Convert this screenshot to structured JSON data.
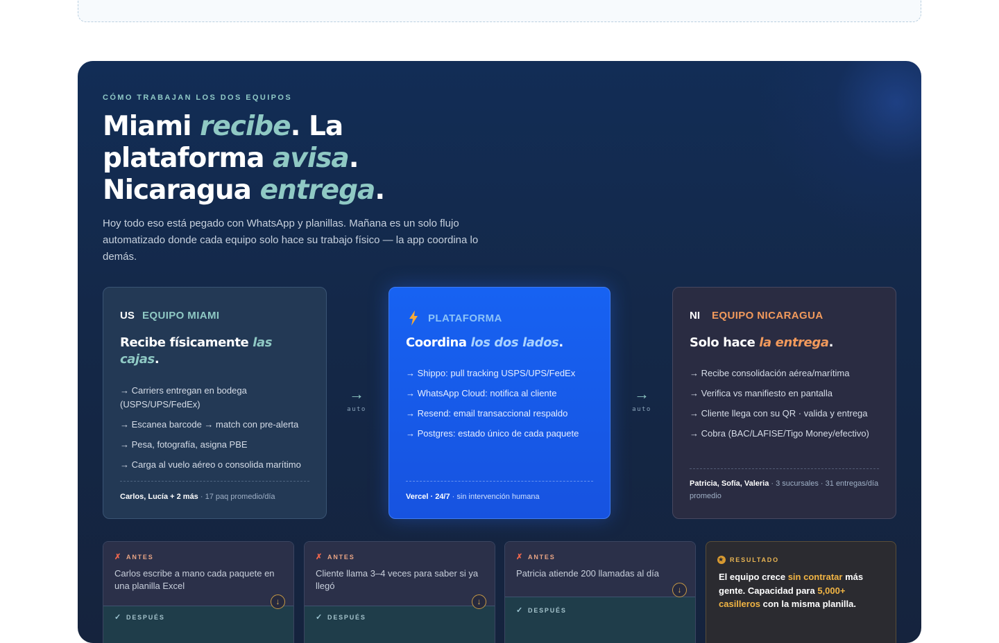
{
  "eyebrow": "CÓMO TRABAJAN LOS DOS EQUIPOS",
  "headline": {
    "l1a": "Miami ",
    "l1b": "recibe",
    "l1c": ". La",
    "l2a": "plataforma ",
    "l2b": "avisa",
    "l2c": ".",
    "l3a": "Nicaragua ",
    "l3b": "entrega",
    "l3c": "."
  },
  "lede": "Hoy todo eso está pegado con WhatsApp y planillas. Mañana es un solo flujo automatizado donde cada equipo solo hace su trabajo físico — la app coordina lo demás.",
  "cards": {
    "miami": {
      "flag": "US",
      "team": "EQUIPO MIAMI",
      "title_a": "Recibe físicamente ",
      "title_b": "las cajas",
      "title_c": ".",
      "bullets": [
        "→ Carriers entregan en bodega (USPS/UPS/FedEx)",
        "→ Escanea barcode → match con pre-alerta",
        "→ Pesa, fotografía, asigna PBE",
        "→ Carga al vuelo aéreo o consolida marítimo"
      ],
      "foot_bold": "Carlos, Lucía + 2 más",
      "foot_rest": " · 17 paq promedio/día"
    },
    "platform": {
      "team": "PLATAFORMA",
      "title_a": "Coordina ",
      "title_b": "los dos lados",
      "title_c": ".",
      "bullets": [
        "→ Shippo: pull tracking USPS/UPS/FedEx",
        "→ WhatsApp Cloud: notifica al cliente",
        "→ Resend: email transaccional respaldo",
        "→ Postgres: estado único de cada paquete"
      ],
      "foot_bold": "Vercel · 24/7",
      "foot_rest": " · sin intervención humana"
    },
    "nicaragua": {
      "flag": "NI",
      "team": "EQUIPO NICARAGUA",
      "title_a": "Solo hace ",
      "title_b": "la entrega",
      "title_c": ".",
      "bullets": [
        "→ Recibe consolidación aérea/marítima",
        "→ Verifica vs manifiesto en pantalla",
        "→ Cliente llega con su QR · valida y entrega",
        "→ Cobra (BAC/LAFISE/Tigo Money/efectivo)"
      ],
      "foot_bold": "Patricia, Sofía, Valeria",
      "foot_rest": " · 3 sucursales · 31 entregas/día promedio"
    }
  },
  "connectors": {
    "arrow": "→",
    "label": "auto"
  },
  "before_after": [
    {
      "before_label": "ANTES",
      "before_text": "Carlos escribe a mano cada paquete en una planilla Excel",
      "after_label": "DESPUÉS"
    },
    {
      "before_label": "ANTES",
      "before_text": "Cliente llama 3–4 veces para saber si ya llegó",
      "after_label": "DESPUÉS"
    },
    {
      "before_label": "ANTES",
      "before_text": "Patricia atiende 200 llamadas al día",
      "after_label": "DESPUÉS"
    }
  ],
  "result": {
    "label": "RESULTADO",
    "t1": "El equipo crece ",
    "t2": "sin contratar",
    "t3": " más gente. Capacidad para ",
    "t4": "5,000+ casilleros",
    "t5": " con la misma planilla."
  },
  "colors": {
    "accent_teal": "#8fc9c4",
    "accent_orange": "#f29a5c",
    "platform_blue": "#1762f2",
    "gold": "#f2b544"
  }
}
